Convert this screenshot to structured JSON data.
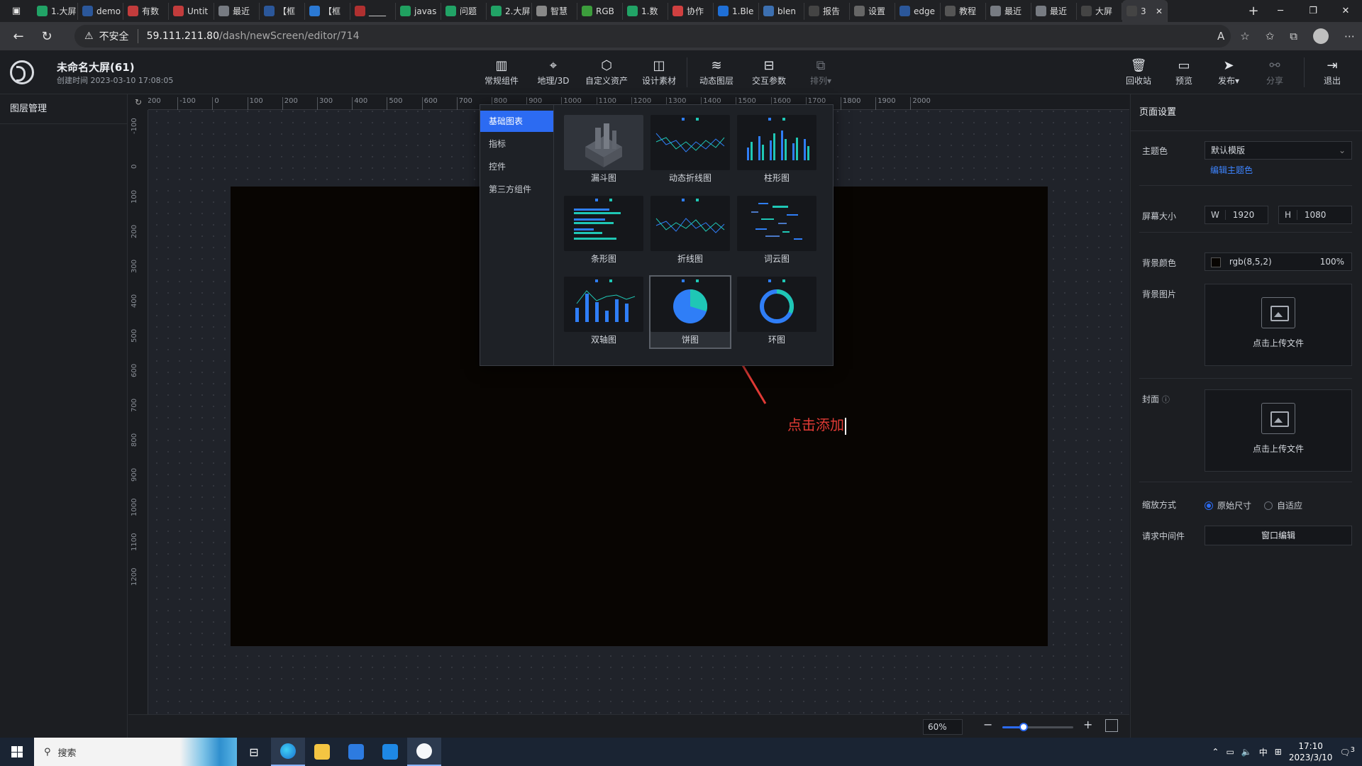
{
  "browser": {
    "tabs": [
      {
        "label": "1.大屏",
        "color": "#21a366"
      },
      {
        "label": "demo",
        "color": "#2b579a"
      },
      {
        "label": "有数",
        "color": "#c23c3c"
      },
      {
        "label": "Untit",
        "color": "#c23c3c"
      },
      {
        "label": "最近",
        "color": "#777b82"
      },
      {
        "label": "【框",
        "color": "#2b579a"
      },
      {
        "label": "【框",
        "color": "#2b79d4"
      },
      {
        "label": "____",
        "color": "#b03030"
      },
      {
        "label": "javas",
        "color": "#20a060"
      },
      {
        "label": "问题",
        "color": "#21a366"
      },
      {
        "label": "2.大屏",
        "color": "#21a366"
      },
      {
        "label": "智慧",
        "color": "#888"
      },
      {
        "label": "RGB",
        "color": "#3c9d3c"
      },
      {
        "label": "1.数",
        "color": "#21a366"
      },
      {
        "label": "协作",
        "color": "#d04040"
      },
      {
        "label": "1.Ble",
        "color": "#1f6fd6"
      },
      {
        "label": "blen",
        "color": "#3c6fb0"
      },
      {
        "label": "报告",
        "color": "#444"
      },
      {
        "label": "设置",
        "color": "#666"
      },
      {
        "label": "edge",
        "color": "#2b579a"
      },
      {
        "label": "教程",
        "color": "#555"
      },
      {
        "label": "最近",
        "color": "#777b82"
      },
      {
        "label": "最近",
        "color": "#777b82"
      },
      {
        "label": "大屏",
        "color": "#444"
      },
      {
        "label": "3",
        "color": "#444",
        "active": true
      }
    ],
    "new_tab": "+",
    "address": {
      "insecure_label": "不安全",
      "host": "59.111.211.80",
      "path": "/dash/newScreen/editor/714"
    }
  },
  "app": {
    "title": "未命名大屏(61)",
    "created_label": "创建时间",
    "created_time": "2023-03-10 17:08:05",
    "toolbar": [
      {
        "label": "常规组件",
        "icon": "bar-chart-icon"
      },
      {
        "label": "地理/3D",
        "icon": "map-pin-icon"
      },
      {
        "label": "自定义资产",
        "icon": "hexagon-icon"
      },
      {
        "label": "设计素材",
        "icon": "assets-icon"
      },
      {
        "label": "动态图层",
        "icon": "layers-icon"
      },
      {
        "label": "交互参数",
        "icon": "sliders-icon"
      },
      {
        "label": "排列",
        "icon": "arrange-icon",
        "disabled": true
      }
    ],
    "right_tools": [
      {
        "label": "回收站",
        "icon": "trash-icon"
      },
      {
        "label": "预览",
        "icon": "preview-icon"
      },
      {
        "label": "发布",
        "icon": "publish-icon"
      },
      {
        "label": "分享",
        "icon": "share-icon",
        "disabled": true
      },
      {
        "label": "退出",
        "icon": "exit-icon"
      }
    ]
  },
  "layers": {
    "title": "图层管理"
  },
  "ruler": {
    "h_ticks": [
      "-200",
      "-100",
      "0",
      "100",
      "200",
      "300",
      "400",
      "500",
      "600",
      "700",
      "800",
      "900",
      "1000",
      "1100",
      "1200",
      "1300",
      "1400",
      "1500",
      "1600",
      "1700",
      "1800",
      "1900",
      "2000"
    ],
    "v_ticks": [
      "-100",
      "0",
      "100",
      "200",
      "300",
      "400",
      "500",
      "600",
      "700",
      "800",
      "900",
      "1000",
      "1100",
      "1200"
    ]
  },
  "picker": {
    "categories": [
      "基础图表",
      "指标",
      "控件",
      "第三方组件"
    ],
    "active_category": "基础图表",
    "items": [
      "漏斗图",
      "动态折线图",
      "柱形图",
      "条形图",
      "折线图",
      "词云图",
      "双轴图",
      "饼图",
      "环图"
    ],
    "selected_item": "饼图"
  },
  "annotation": {
    "text": "点击添加",
    "color": "#e03a35"
  },
  "settings": {
    "title": "页面设置",
    "theme_label": "主题色",
    "theme_value": "默认模版",
    "theme_edit": "编辑主题色",
    "size_label": "屏幕大小",
    "width_label": "W",
    "width": "1920",
    "height_label": "H",
    "height": "1080",
    "bg_color_label": "背景颜色",
    "bg_color_value": "rgb(8,5,2)",
    "bg_color_opacity": "100%",
    "bg_color_swatch": "#080502",
    "bg_image_label": "背景图片",
    "upload_text": "点击上传文件",
    "cover_label": "封面",
    "scale_label": "缩放方式",
    "scale_options": [
      "原始尺寸",
      "自适应"
    ],
    "scale_selected": "原始尺寸",
    "middleware_label": "请求中间件",
    "middleware_button": "窗口编辑"
  },
  "footer": {
    "zoom": "60%",
    "zoom_fraction": 0.3
  },
  "taskbar": {
    "search_placeholder": "搜索",
    "time": "17:10",
    "date": "2023/3/10",
    "ime": "中",
    "notifications": "3"
  }
}
